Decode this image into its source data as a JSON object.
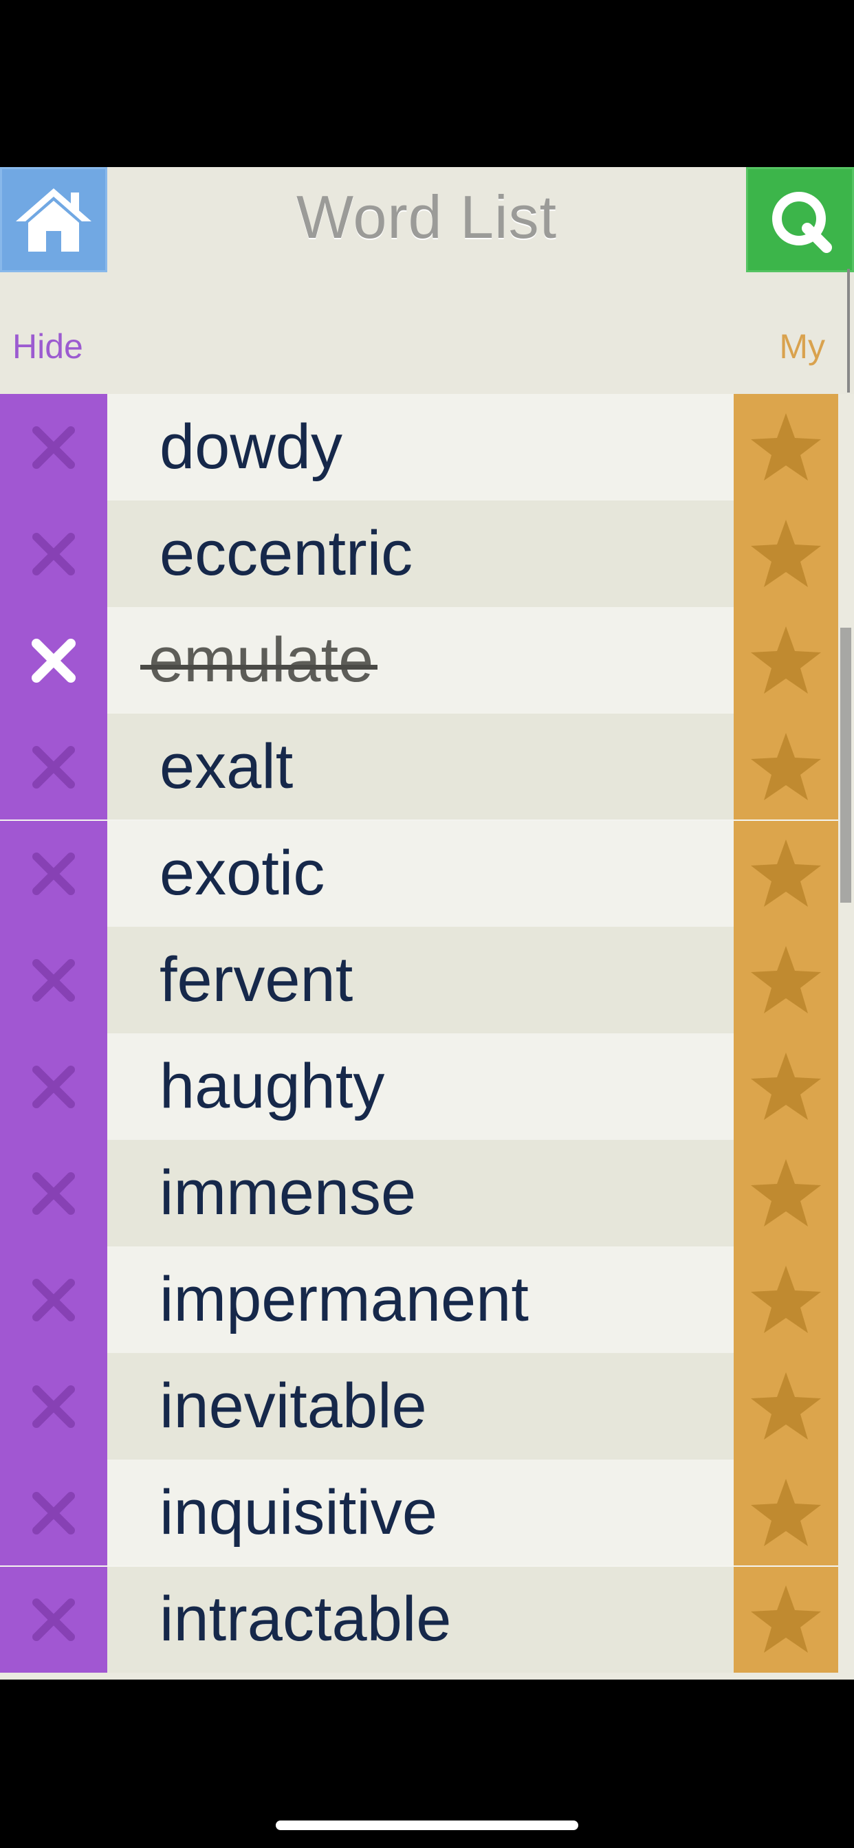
{
  "header": {
    "title": "Word List",
    "home_icon": "home-icon",
    "search_icon": "quiz-q-icon"
  },
  "columns": {
    "hide_label": "Hide",
    "my_label": "My"
  },
  "words": [
    {
      "word": "dowdy",
      "hidden": false
    },
    {
      "word": "eccentric",
      "hidden": false
    },
    {
      "word": "emulate",
      "hidden": true
    },
    {
      "word": "exalt",
      "hidden": false
    },
    {
      "word": "exotic",
      "hidden": false
    },
    {
      "word": "fervent",
      "hidden": false
    },
    {
      "word": "haughty",
      "hidden": false
    },
    {
      "word": "immense",
      "hidden": false
    },
    {
      "word": "impermanent",
      "hidden": false
    },
    {
      "word": "inevitable",
      "hidden": false
    },
    {
      "word": "inquisitive",
      "hidden": false
    },
    {
      "word": "intractable",
      "hidden": false
    }
  ],
  "colors": {
    "hide_column": "#a157d2",
    "star_column": "#dca54c",
    "home_button": "#71a8e3",
    "search_button": "#3cb54a"
  }
}
